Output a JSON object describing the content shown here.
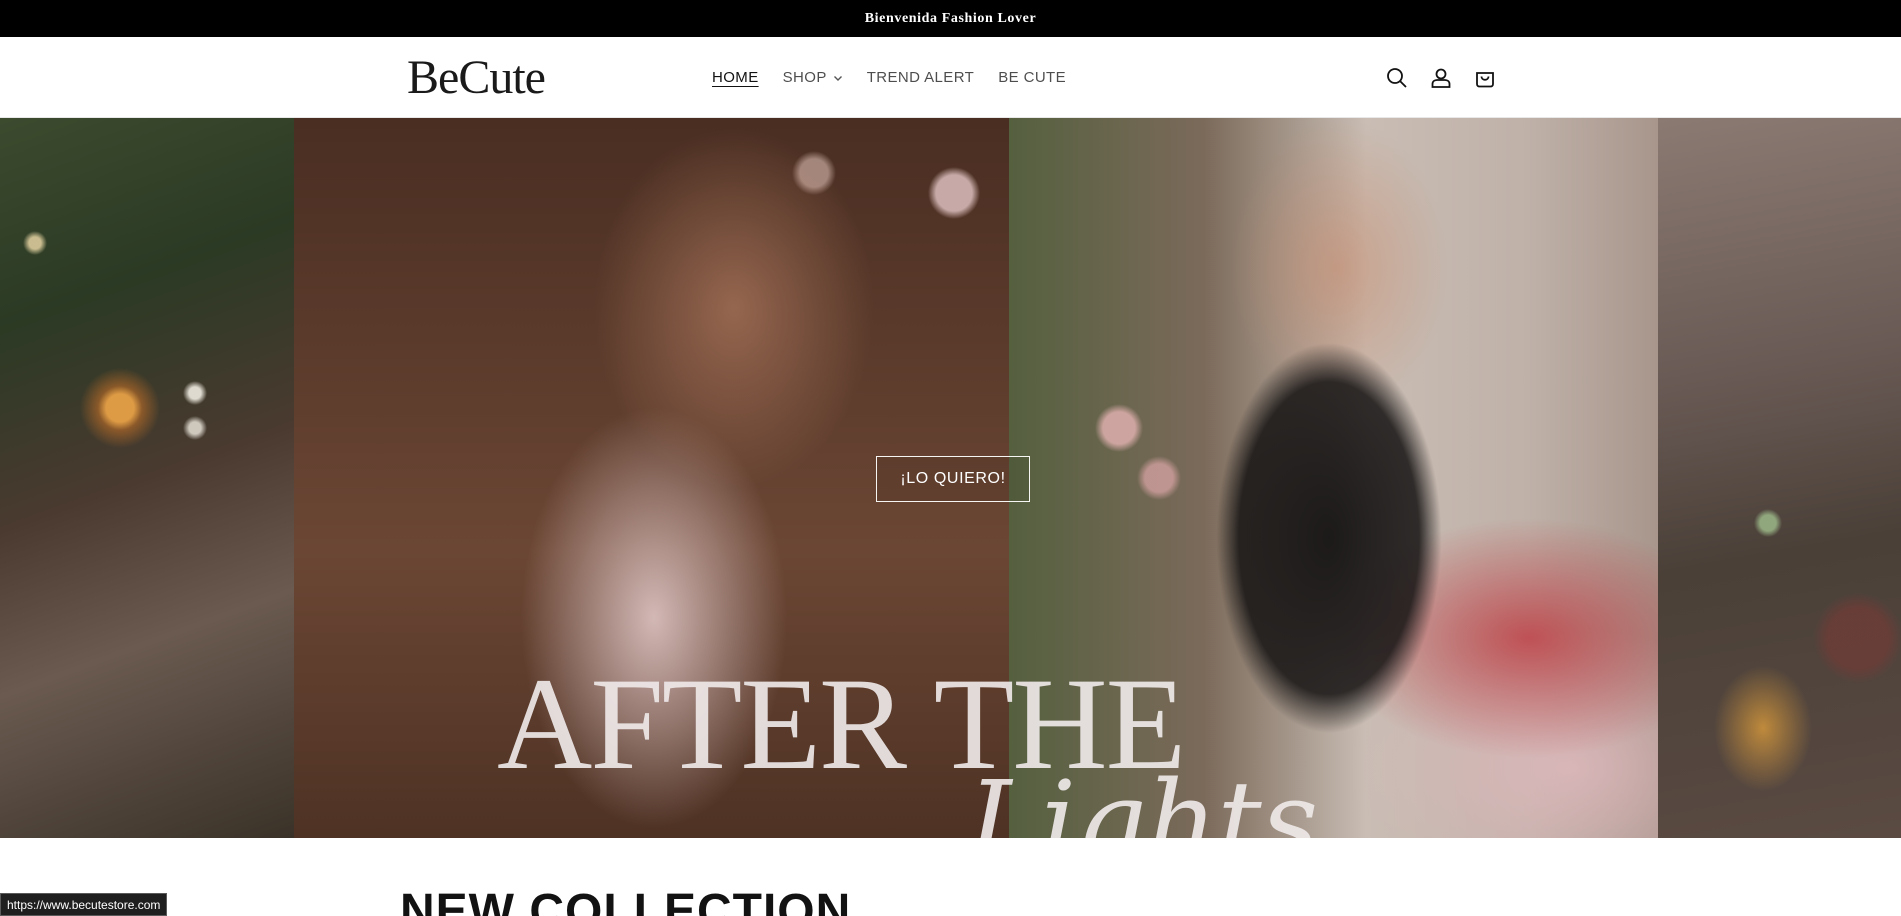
{
  "announcement": {
    "text": "Bienvenida Fashion Lover"
  },
  "header": {
    "logo": "BeCute",
    "nav": [
      {
        "label": "HOME",
        "active": true
      },
      {
        "label": "SHOP",
        "dropdown": true
      },
      {
        "label": "TREND ALERT"
      },
      {
        "label": "BE CUTE"
      }
    ],
    "icons": [
      "search-icon",
      "account-icon",
      "cart-icon"
    ]
  },
  "hero": {
    "cta_label": "¡LO QUIERO!",
    "title": "AFTER THE",
    "script": "Lights"
  },
  "section": {
    "title": "NEW COLLECTION"
  },
  "status_bar": {
    "url": "https://www.becutestore.com"
  },
  "colors": {
    "announcement_bg": "#000000",
    "text": "#121212",
    "hero_text": "#eee8e8"
  }
}
